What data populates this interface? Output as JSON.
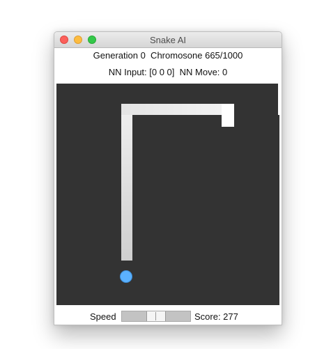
{
  "window": {
    "title": "Snake AI"
  },
  "info": {
    "generation_line": "Generation 0  Chromosone 665/1000",
    "nn_line": "NN Input: [0 0 0]  NN Move: 0"
  },
  "controls": {
    "speed_label": "Speed",
    "speed_fraction": 0.5,
    "score_label": "Score: 277"
  },
  "colors": {
    "board": "#333333",
    "snake": "#e8e8e8",
    "food": "#5bb1ff",
    "close": "#fc605b",
    "minimize": "#fdbc40",
    "maximize": "#34c84a"
  }
}
